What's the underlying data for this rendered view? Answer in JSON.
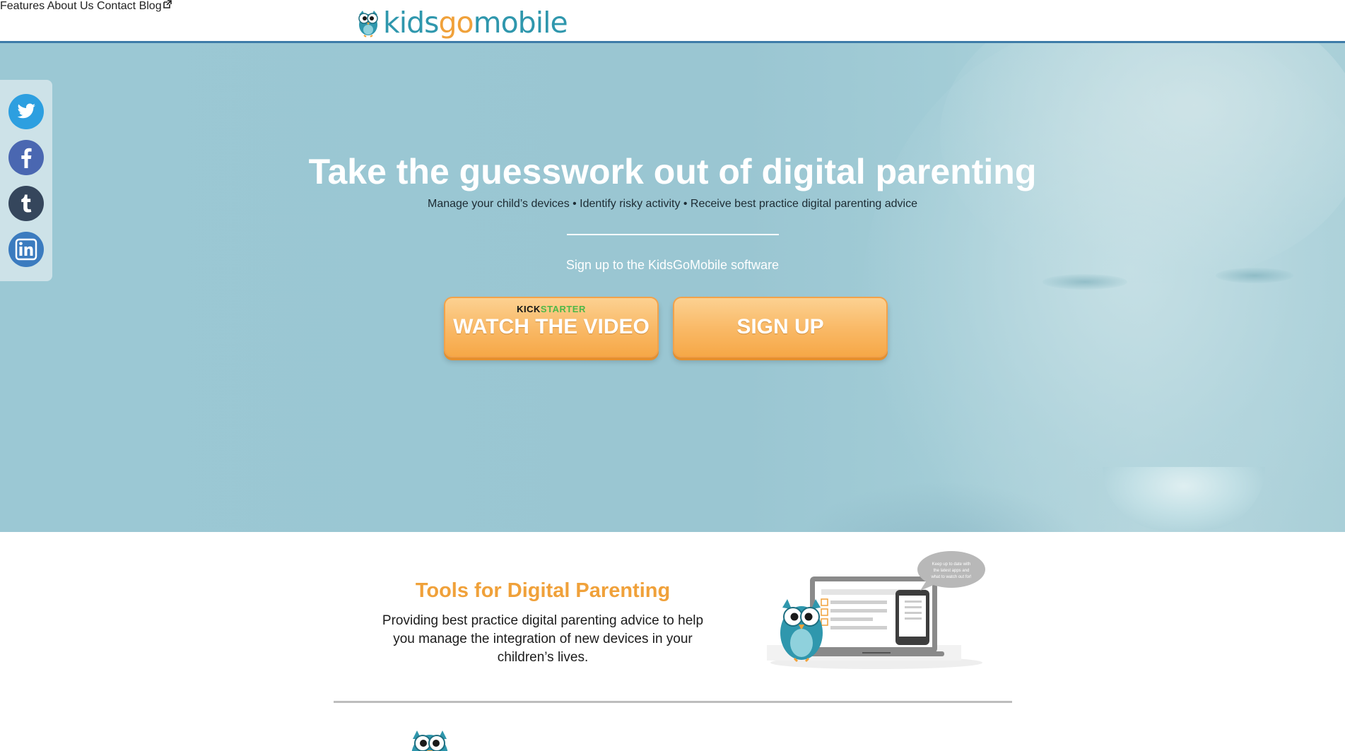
{
  "header": {
    "logo": {
      "kids": "kids",
      "go": "go",
      "mobile": "mobile"
    },
    "nav": [
      {
        "label": "Features"
      },
      {
        "label": "About Us"
      },
      {
        "label": "Contact"
      },
      {
        "label": "Blog"
      }
    ]
  },
  "hero": {
    "title": "Take the guesswork out of digital parenting",
    "subtitle": "Manage your child’s devices • Identify risky activity • Receive best practice digital parenting advice",
    "signup_text": "Sign up to the KidsGoMobile software",
    "video_button": {
      "kick": "KICK",
      "starter": "STARTER",
      "label": "WATCH THE VIDEO"
    },
    "signup_button": {
      "label": "SIGN UP"
    }
  },
  "social": [
    {
      "name": "twitter-icon",
      "color": "#2d9fe0"
    },
    {
      "name": "facebook-icon",
      "color": "#4a67b1"
    },
    {
      "name": "tumblr-icon",
      "color": "#35465c"
    },
    {
      "name": "linkedin-icon",
      "color": "#3b7bbf"
    }
  ],
  "tools": {
    "title": "Tools for Digital Parenting",
    "description": "Providing best practice digital parenting advice to help you manage the integration of new devices in your children’s lives.",
    "speech_bubble": "Keep up to date with the latest apps and what to watch out for!"
  },
  "colors": {
    "brand_blue": "#2f97ad",
    "brand_orange": "#f0a13a",
    "header_rule": "#3d7ba8",
    "button": "#f9b865"
  }
}
